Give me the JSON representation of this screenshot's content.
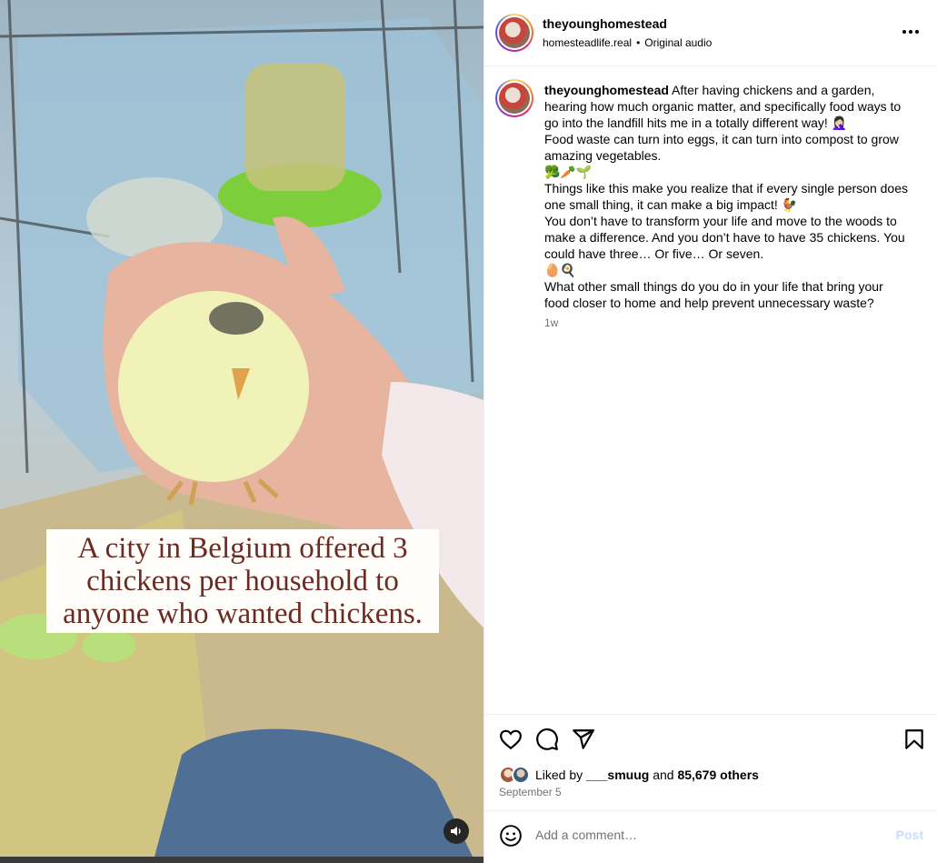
{
  "media": {
    "caption_text": "A city in Belgium offered 3\nchickens per household to\nanyone who wanted chickens.",
    "audio_icon": "speaker-icon"
  },
  "header": {
    "username": "theyounghomestead",
    "subtitle_account": "homesteadlife.real",
    "subtitle_separator": "•",
    "subtitle_audio": "Original audio",
    "more_icon": "more-horizontal-icon"
  },
  "caption": {
    "username": "theyounghomestead",
    "lines": [
      "After having chickens and a garden, hearing how much organic matter, and specifically food ways to go into the landfill hits me in a totally different way! 🤦🏻‍♀️",
      "Food waste can turn into eggs, it can turn into compost to grow amazing vegetables.",
      "🥦🥕🌱",
      "Things like this make you realize that if every single person does one small thing, it can make a big impact! 🐓",
      "You don’t have to transform your life and move to the woods to make a difference. And you don’t have to have 35 chickens. You could have three… Or five… Or seven.",
      "🥚🍳",
      "What other small things do you do in your life that bring your food closer to home and help prevent unnecessary waste?"
    ],
    "time": "1w"
  },
  "actions": {
    "like_icon": "heart-icon",
    "comment_icon": "comment-icon",
    "share_icon": "send-icon",
    "save_icon": "bookmark-icon",
    "liked_by_prefix": "Liked by",
    "liked_by_user": "___smuug",
    "liked_by_and": "and",
    "liked_by_others": "85,679 others",
    "date": "September 5"
  },
  "comment_box": {
    "emoji_icon": "emoji-icon",
    "placeholder": "Add a comment…",
    "post_label": "Post"
  },
  "colors": {
    "caption_text": "#6b2a22",
    "post_button_disabled": "#c6e0fb",
    "secondary_text": "#737373"
  }
}
